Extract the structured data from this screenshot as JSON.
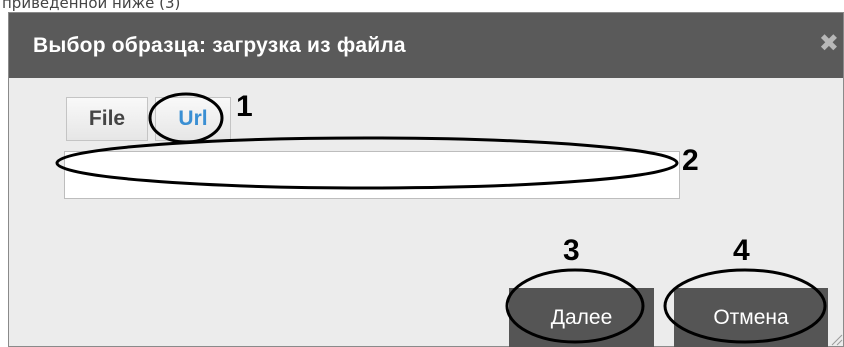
{
  "caption_fragment": "приведенной ниже (3)",
  "dialog": {
    "title": "Выбор образца: загрузка из файла",
    "close_symbol": "✖"
  },
  "tabs": [
    {
      "label": "File",
      "active": false
    },
    {
      "label": "Url",
      "active": true
    }
  ],
  "url_input": {
    "value": "",
    "placeholder": ""
  },
  "buttons": {
    "next_label": "Далее",
    "cancel_label": "Отмена"
  },
  "annotations": {
    "marker_1": "1",
    "marker_2": "2",
    "marker_3": "3",
    "marker_4": "4"
  },
  "colors": {
    "titlebar": "#5a5a5a",
    "dialog_bg": "#ececec",
    "button_bg": "#555555",
    "active_tab_text": "#3a8fd3",
    "annotation": "#000000"
  }
}
